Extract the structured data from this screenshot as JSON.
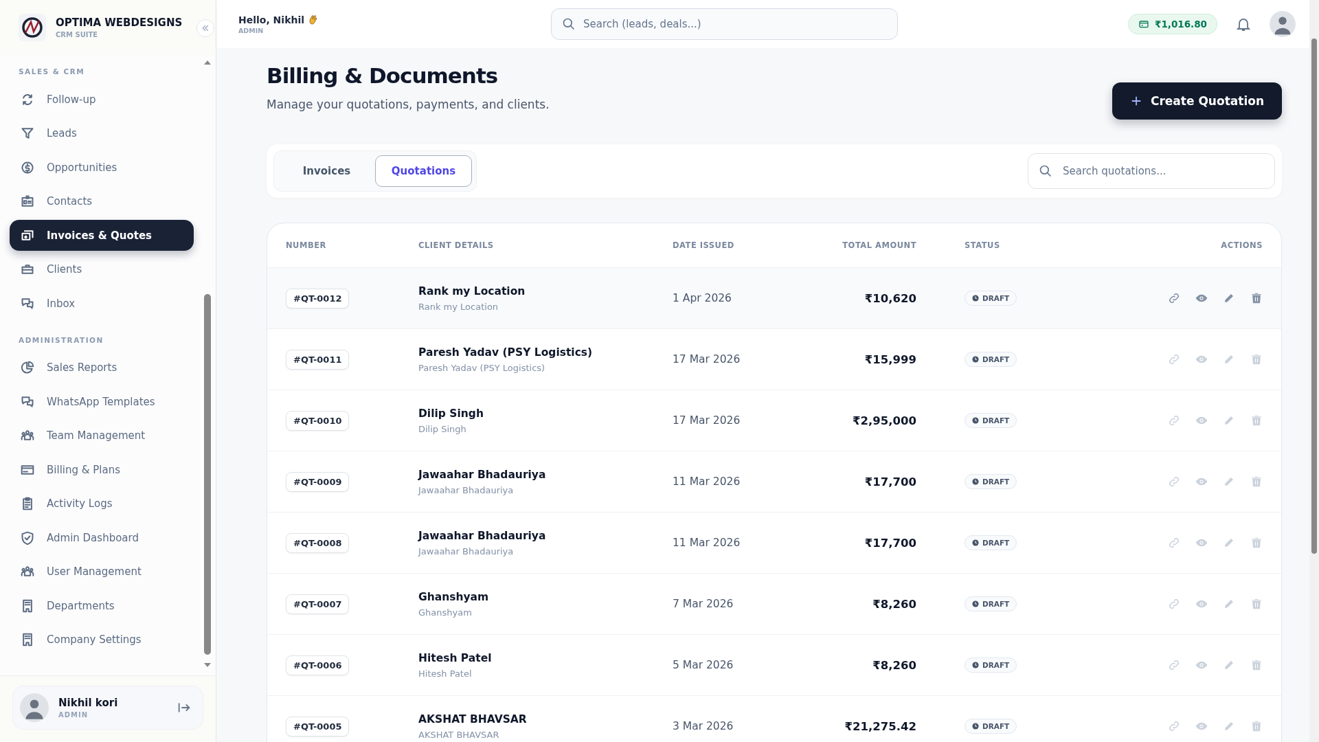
{
  "brand": {
    "name": "OPTIMA WEBDESIGNS",
    "subtitle": "CRM SUITE"
  },
  "sidebar": {
    "sections": [
      {
        "title": "SALES & CRM",
        "items": [
          {
            "label": "Follow-up",
            "selected": false
          },
          {
            "label": "Leads",
            "selected": false
          },
          {
            "label": "Opportunities",
            "selected": false
          },
          {
            "label": "Contacts",
            "selected": false
          },
          {
            "label": "Invoices & Quotes",
            "selected": true
          },
          {
            "label": "Clients",
            "selected": false
          },
          {
            "label": "Inbox",
            "selected": false
          }
        ]
      },
      {
        "title": "ADMINISTRATION",
        "items": [
          {
            "label": "Sales Reports",
            "selected": false
          },
          {
            "label": "WhatsApp Templates",
            "selected": false
          },
          {
            "label": "Team Management",
            "selected": false
          },
          {
            "label": "Billing & Plans",
            "selected": false
          },
          {
            "label": "Activity Logs",
            "selected": false
          },
          {
            "label": "Admin Dashboard",
            "selected": false
          },
          {
            "label": "User Management",
            "selected": false
          },
          {
            "label": "Departments",
            "selected": false
          },
          {
            "label": "Company Settings",
            "selected": false
          }
        ]
      }
    ],
    "user": {
      "name": "Nikhil kori",
      "role": "ADMIN"
    }
  },
  "header": {
    "greeting": "Hello, Nikhil",
    "role": "ADMIN",
    "search": {
      "placeholder": "Search (leads, deals...)"
    },
    "balance": "₹1,016.80"
  },
  "page": {
    "title": "Billing & Documents",
    "subtitle": "Manage your quotations, payments, and clients.",
    "create_button": "Create Quotation"
  },
  "tabs": [
    {
      "label": "Invoices",
      "selected": false
    },
    {
      "label": "Quotations",
      "selected": true
    }
  ],
  "table_search": {
    "placeholder": "Search quotations..."
  },
  "table": {
    "columns": [
      "NUMBER",
      "CLIENT DETAILS",
      "DATE ISSUED",
      "TOTAL AMOUNT",
      "STATUS",
      "ACTIONS"
    ],
    "rows": [
      {
        "number": "#QT-0012",
        "client": "Rank my Location",
        "contact": "Rank my Location",
        "date": "1 Apr 2026",
        "amount": "₹10,620",
        "status": "DRAFT",
        "highlighted": true
      },
      {
        "number": "#QT-0011",
        "client": "Paresh Yadav (PSY Logistics)",
        "contact": "Paresh Yadav (PSY Logistics)",
        "date": "17 Mar 2026",
        "amount": "₹15,999",
        "status": "DRAFT",
        "highlighted": false
      },
      {
        "number": "#QT-0010",
        "client": "Dilip Singh",
        "contact": "Dilip Singh",
        "date": "17 Mar 2026",
        "amount": "₹2,95,000",
        "status": "DRAFT",
        "highlighted": false
      },
      {
        "number": "#QT-0009",
        "client": "Jawaahar Bhadauriya",
        "contact": "Jawaahar Bhadauriya",
        "date": "11 Mar 2026",
        "amount": "₹17,700",
        "status": "DRAFT",
        "highlighted": false
      },
      {
        "number": "#QT-0008",
        "client": "Jawaahar Bhadauriya",
        "contact": "Jawaahar Bhadauriya",
        "date": "11 Mar 2026",
        "amount": "₹17,700",
        "status": "DRAFT",
        "highlighted": false
      },
      {
        "number": "#QT-0007",
        "client": "Ghanshyam",
        "contact": "Ghanshyam",
        "date": "7 Mar 2026",
        "amount": "₹8,260",
        "status": "DRAFT",
        "highlighted": false
      },
      {
        "number": "#QT-0006",
        "client": "Hitesh Patel",
        "contact": "Hitesh Patel",
        "date": "5 Mar 2026",
        "amount": "₹8,260",
        "status": "DRAFT",
        "highlighted": false
      },
      {
        "number": "#QT-0005",
        "client": "AKSHAT BHAVSAR",
        "contact": "AKSHAT BHAVSAR",
        "date": "3 Mar 2026",
        "amount": "₹21,275.42",
        "status": "DRAFT",
        "highlighted": false
      }
    ]
  }
}
